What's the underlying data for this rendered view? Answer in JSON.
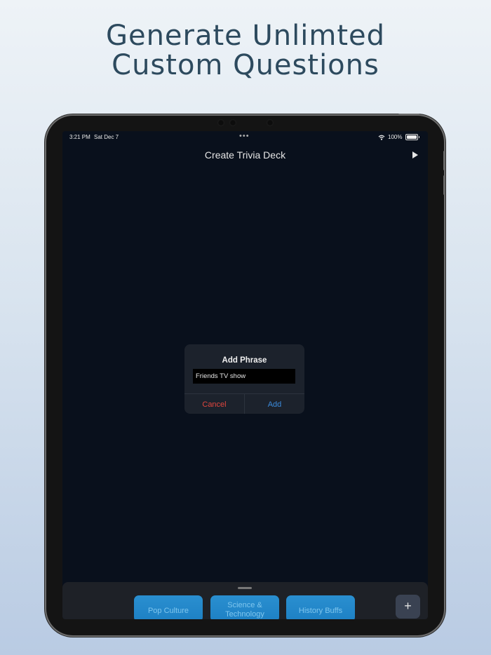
{
  "headline": {
    "line1": "Generate Unlimted",
    "line2": "Custom Questions"
  },
  "status_bar": {
    "time": "3:21 PM",
    "date": "Sat Dec 7",
    "battery": "100%"
  },
  "nav": {
    "title": "Create Trivia Deck",
    "play_icon": "play-icon"
  },
  "alert": {
    "title": "Add Phrase",
    "input_value": "Friends TV show",
    "cancel_label": "Cancel",
    "add_label": "Add"
  },
  "decks": [
    {
      "label": "Pop Culture"
    },
    {
      "label": "Science & Technology"
    },
    {
      "label": "History Buffs"
    }
  ],
  "add_deck_label": "+",
  "colors": {
    "accent": "#3b8bdc",
    "destructive": "#e0463e",
    "tile": "#2a8fd0"
  }
}
